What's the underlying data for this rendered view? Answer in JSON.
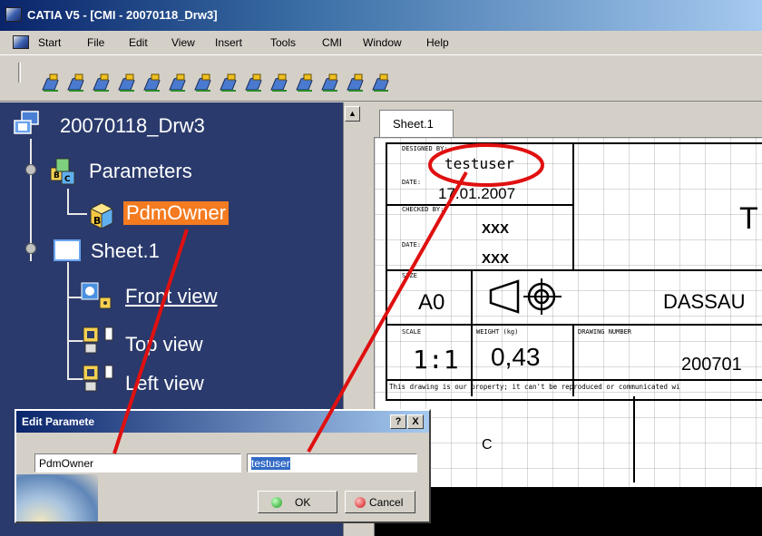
{
  "window": {
    "title": "CATIA V5 - [CMI - 20070118_Drw3]"
  },
  "menu": {
    "items": [
      "Start",
      "File",
      "Edit",
      "View",
      "Insert",
      "Tools",
      "CMI",
      "Window",
      "Help"
    ]
  },
  "toolbar": {
    "icons": [
      "drawing-tool-icon",
      "drawing-tool-icon",
      "drawing-tool-icon",
      "drawing-tool-icon",
      "drawing-tool-icon",
      "drawing-tool-icon",
      "drawing-tool-icon",
      "drawing-tool-icon",
      "drawing-tool-icon",
      "drawing-tool-icon",
      "drawing-tool-icon",
      "drawing-tool-icon",
      "drawing-tool-icon",
      "drawing-tool-icon"
    ]
  },
  "tree": {
    "root": "20070118_Drw3",
    "parameters": "Parameters",
    "pdm_owner": "PdmOwner",
    "sheet": "Sheet.1",
    "front_view": "Front view",
    "top_view": "Top view",
    "left_view": "Left view"
  },
  "drawing": {
    "sheet_tab": "Sheet.1",
    "title_block": {
      "designed_by_label": "DESIGNED BY:",
      "designed_by_value": "testuser",
      "date_label": "DATE:",
      "date_value": "17.01.2007",
      "checked_by_label": "CHECKED BY:",
      "checked_by_value": "XXX",
      "date2_label": "DATE:",
      "date2_value": "XXX",
      "size_label": "SIZE",
      "size_value": "A0",
      "company": "DASSAU",
      "title_partial": "T",
      "scale_label": "SCALE",
      "scale_value": "1:1",
      "weight_label": "WEIGHT (kg)",
      "weight_value": "0,43",
      "drawing_number_label": "DRAWING NUMBER",
      "drawing_number_value": "200701",
      "disclaimer": "This drawing is our property; it can't be reproduced or communicated wi",
      "grid_letter": "C"
    }
  },
  "dialog": {
    "title": "Edit Paramete",
    "help": "?",
    "close": "X",
    "name_value": "PdmOwner",
    "param_value": "testuser",
    "ok_label": "OK",
    "cancel_label": "Cancel"
  },
  "colors": {
    "tree_background": "#2a3a6c",
    "selection": "#f47b20",
    "annotation": "#e01010",
    "title_bar": "#0a246a"
  }
}
